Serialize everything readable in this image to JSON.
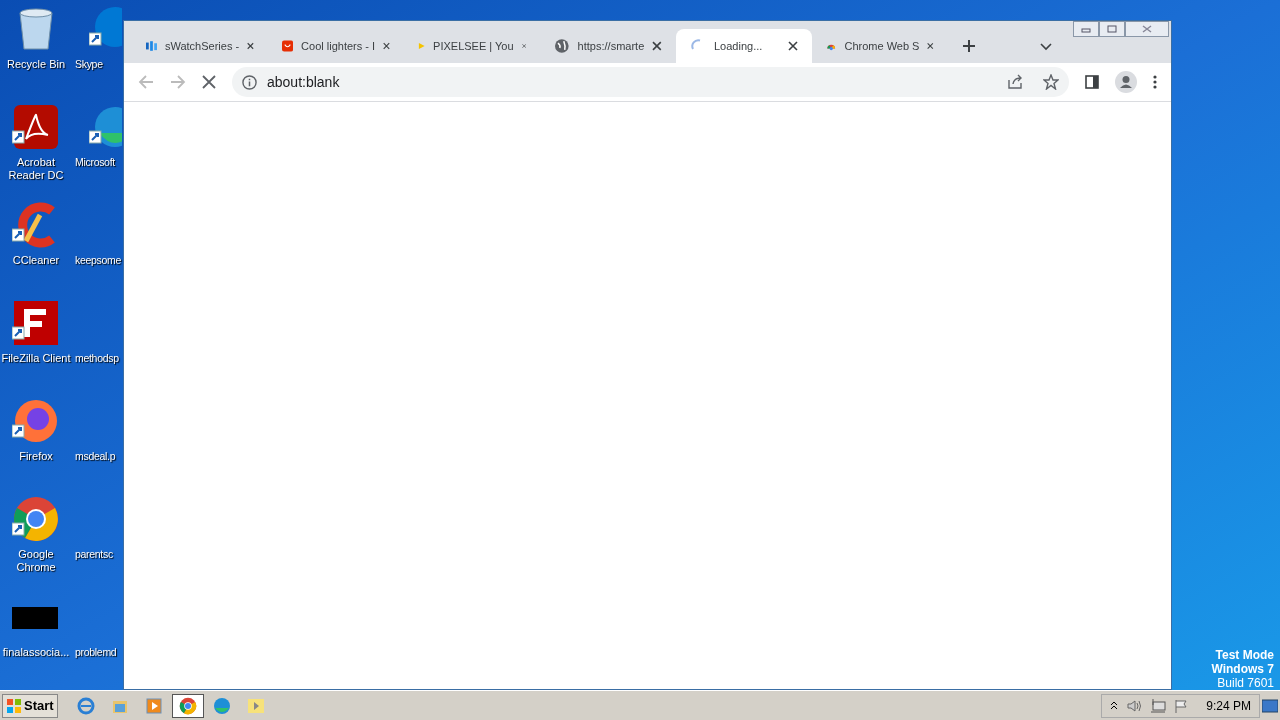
{
  "desktop_columns": [
    [
      {
        "label": "Recycle Bin",
        "kind": "recycle"
      },
      {
        "label": "Acrobat Reader DC",
        "kind": "acrobat"
      },
      {
        "label": "CCleaner",
        "kind": "ccleaner"
      },
      {
        "label": "FileZilla Client",
        "kind": "filezilla"
      },
      {
        "label": "Firefox",
        "kind": "firefox"
      },
      {
        "label": "Google Chrome",
        "kind": "chrome"
      },
      {
        "label": "finalassocia...",
        "kind": "black"
      }
    ],
    [
      {
        "label": "Skype",
        "kind": "skype"
      },
      {
        "label": "Microsoft",
        "kind": "edge"
      },
      {
        "label": "keepsome",
        "kind": "file"
      },
      {
        "label": "methodsp",
        "kind": "file"
      },
      {
        "label": "msdeal.p",
        "kind": "file"
      },
      {
        "label": "parentsc",
        "kind": "file"
      },
      {
        "label": "problemd",
        "kind": "file"
      }
    ]
  ],
  "browser": {
    "tabs": [
      {
        "title": "sWatchSeries -",
        "kind": "bars",
        "selected": false
      },
      {
        "title": "Cool lighters - I",
        "kind": "shop",
        "selected": false
      },
      {
        "title": "PIXELSEE | You",
        "kind": "play",
        "selected": false
      },
      {
        "title": "https://smarte",
        "kind": "globe",
        "selected": false
      },
      {
        "title": "Loading...",
        "kind": "spinner",
        "selected": true
      },
      {
        "title": "Chrome Web S",
        "kind": "rainbow",
        "selected": false
      }
    ],
    "address": "about:blank"
  },
  "watermark_text": [
    "Test Mode",
    "Windows 7",
    "Build 7601"
  ],
  "taskbar": {
    "start": "Start",
    "apps": [
      {
        "kind": "ie",
        "selected": false
      },
      {
        "kind": "folder",
        "selected": false
      },
      {
        "kind": "media",
        "selected": false
      },
      {
        "kind": "chrome",
        "selected": true
      },
      {
        "kind": "edge",
        "selected": false
      },
      {
        "kind": "pixel",
        "selected": false
      }
    ],
    "time": "9:24 PM"
  }
}
